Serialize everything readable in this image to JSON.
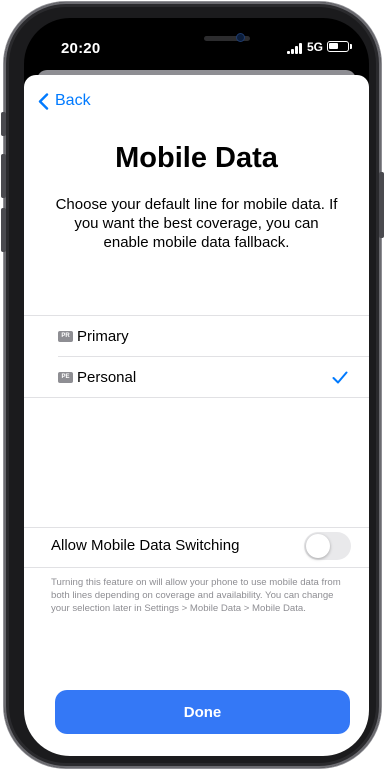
{
  "status_bar": {
    "time": "20:20",
    "network": "5G",
    "battery_level": 0.55,
    "signal_icon": "signal-bars-icon"
  },
  "nav": {
    "back_label": "Back",
    "back_icon": "chevron-left-icon"
  },
  "page": {
    "title": "Mobile Data",
    "subtitle": "Choose your default line for mobile data. If you want the best coverage, you can enable mobile data fallback."
  },
  "lines": [
    {
      "badge": "PR",
      "label": "Primary",
      "selected": false
    },
    {
      "badge": "PE",
      "label": "Personal",
      "selected": true
    }
  ],
  "switching": {
    "label": "Allow Mobile Data Switching",
    "enabled": false,
    "footnote": "Turning this feature on will allow your phone to use mobile data from both lines depending on coverage and availability. You can change your selection later in Settings > Mobile Data > Mobile Data."
  },
  "done_label": "Done",
  "colors": {
    "accent": "#007aff",
    "button": "#3478f6",
    "secondary_text": "#8e8e93",
    "separator": "#e1e1e4"
  }
}
